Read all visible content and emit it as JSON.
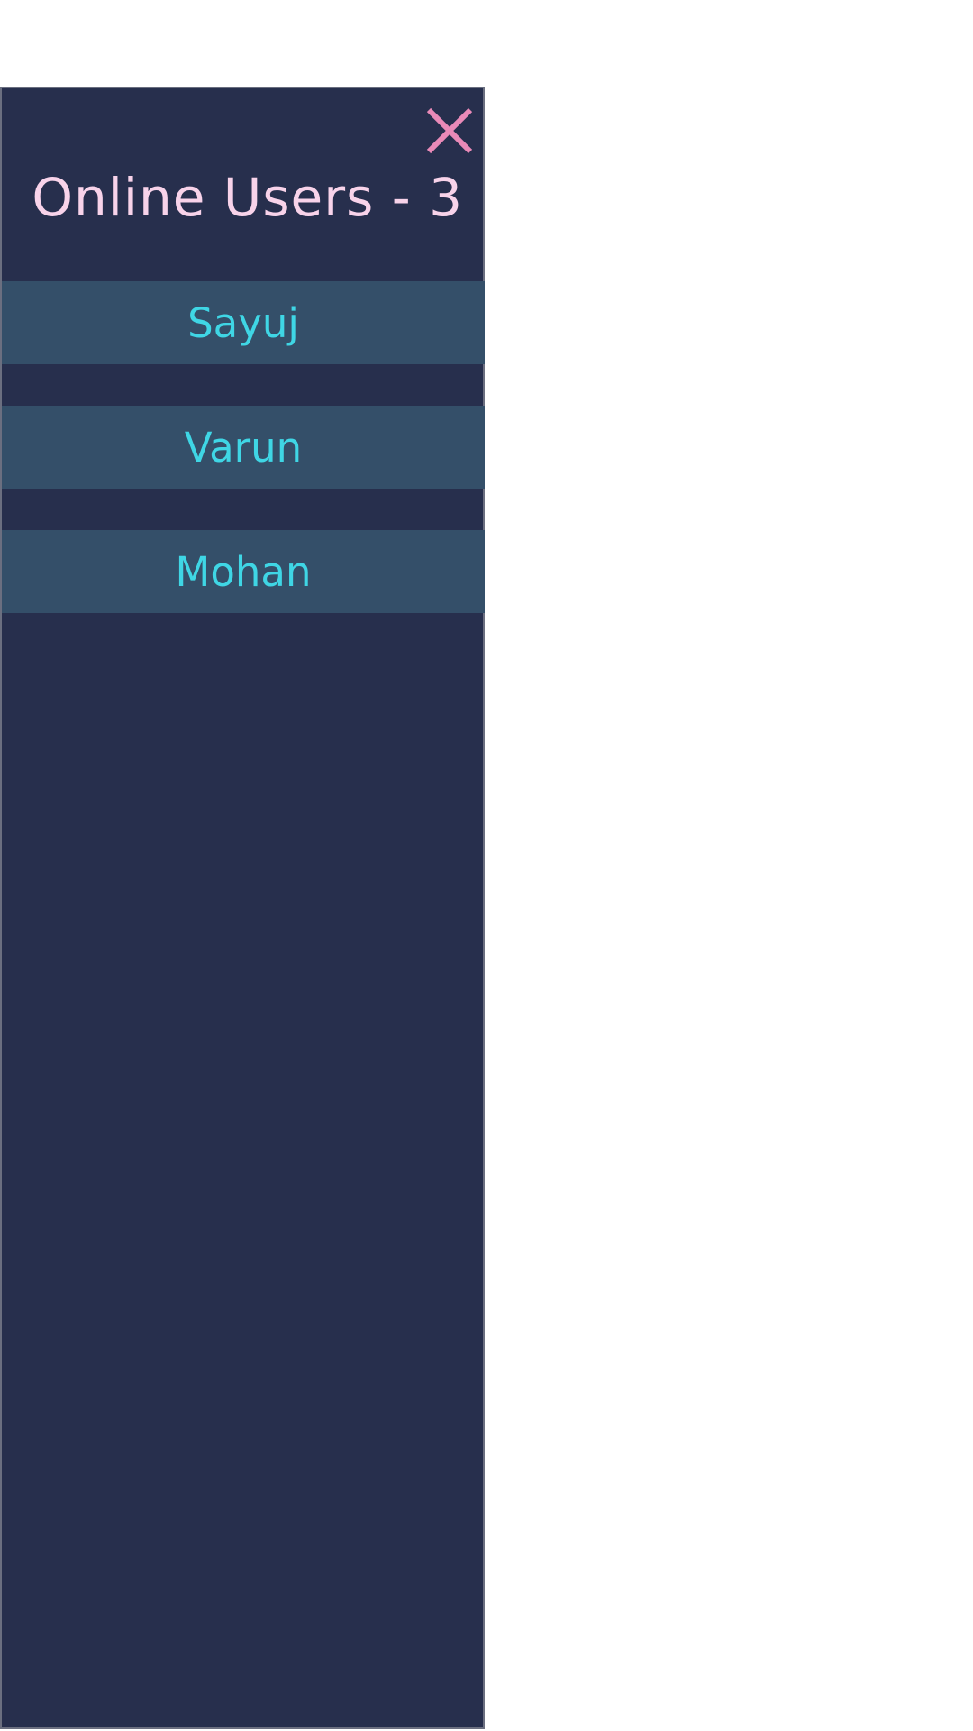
{
  "panel": {
    "title": "Online Users - 3",
    "close_icon": "close-icon",
    "users": [
      {
        "name": "Sayuj"
      },
      {
        "name": "Varun"
      },
      {
        "name": "Mohan"
      }
    ]
  },
  "colors": {
    "panel_background": "#272f4d",
    "panel_border": "#6b6f80",
    "title_text": "#f8d3ea",
    "close_icon": "#e98ab8",
    "user_row_background": "#344f69",
    "user_name_text": "#3fd6e5",
    "page_background": "#ffffff"
  }
}
